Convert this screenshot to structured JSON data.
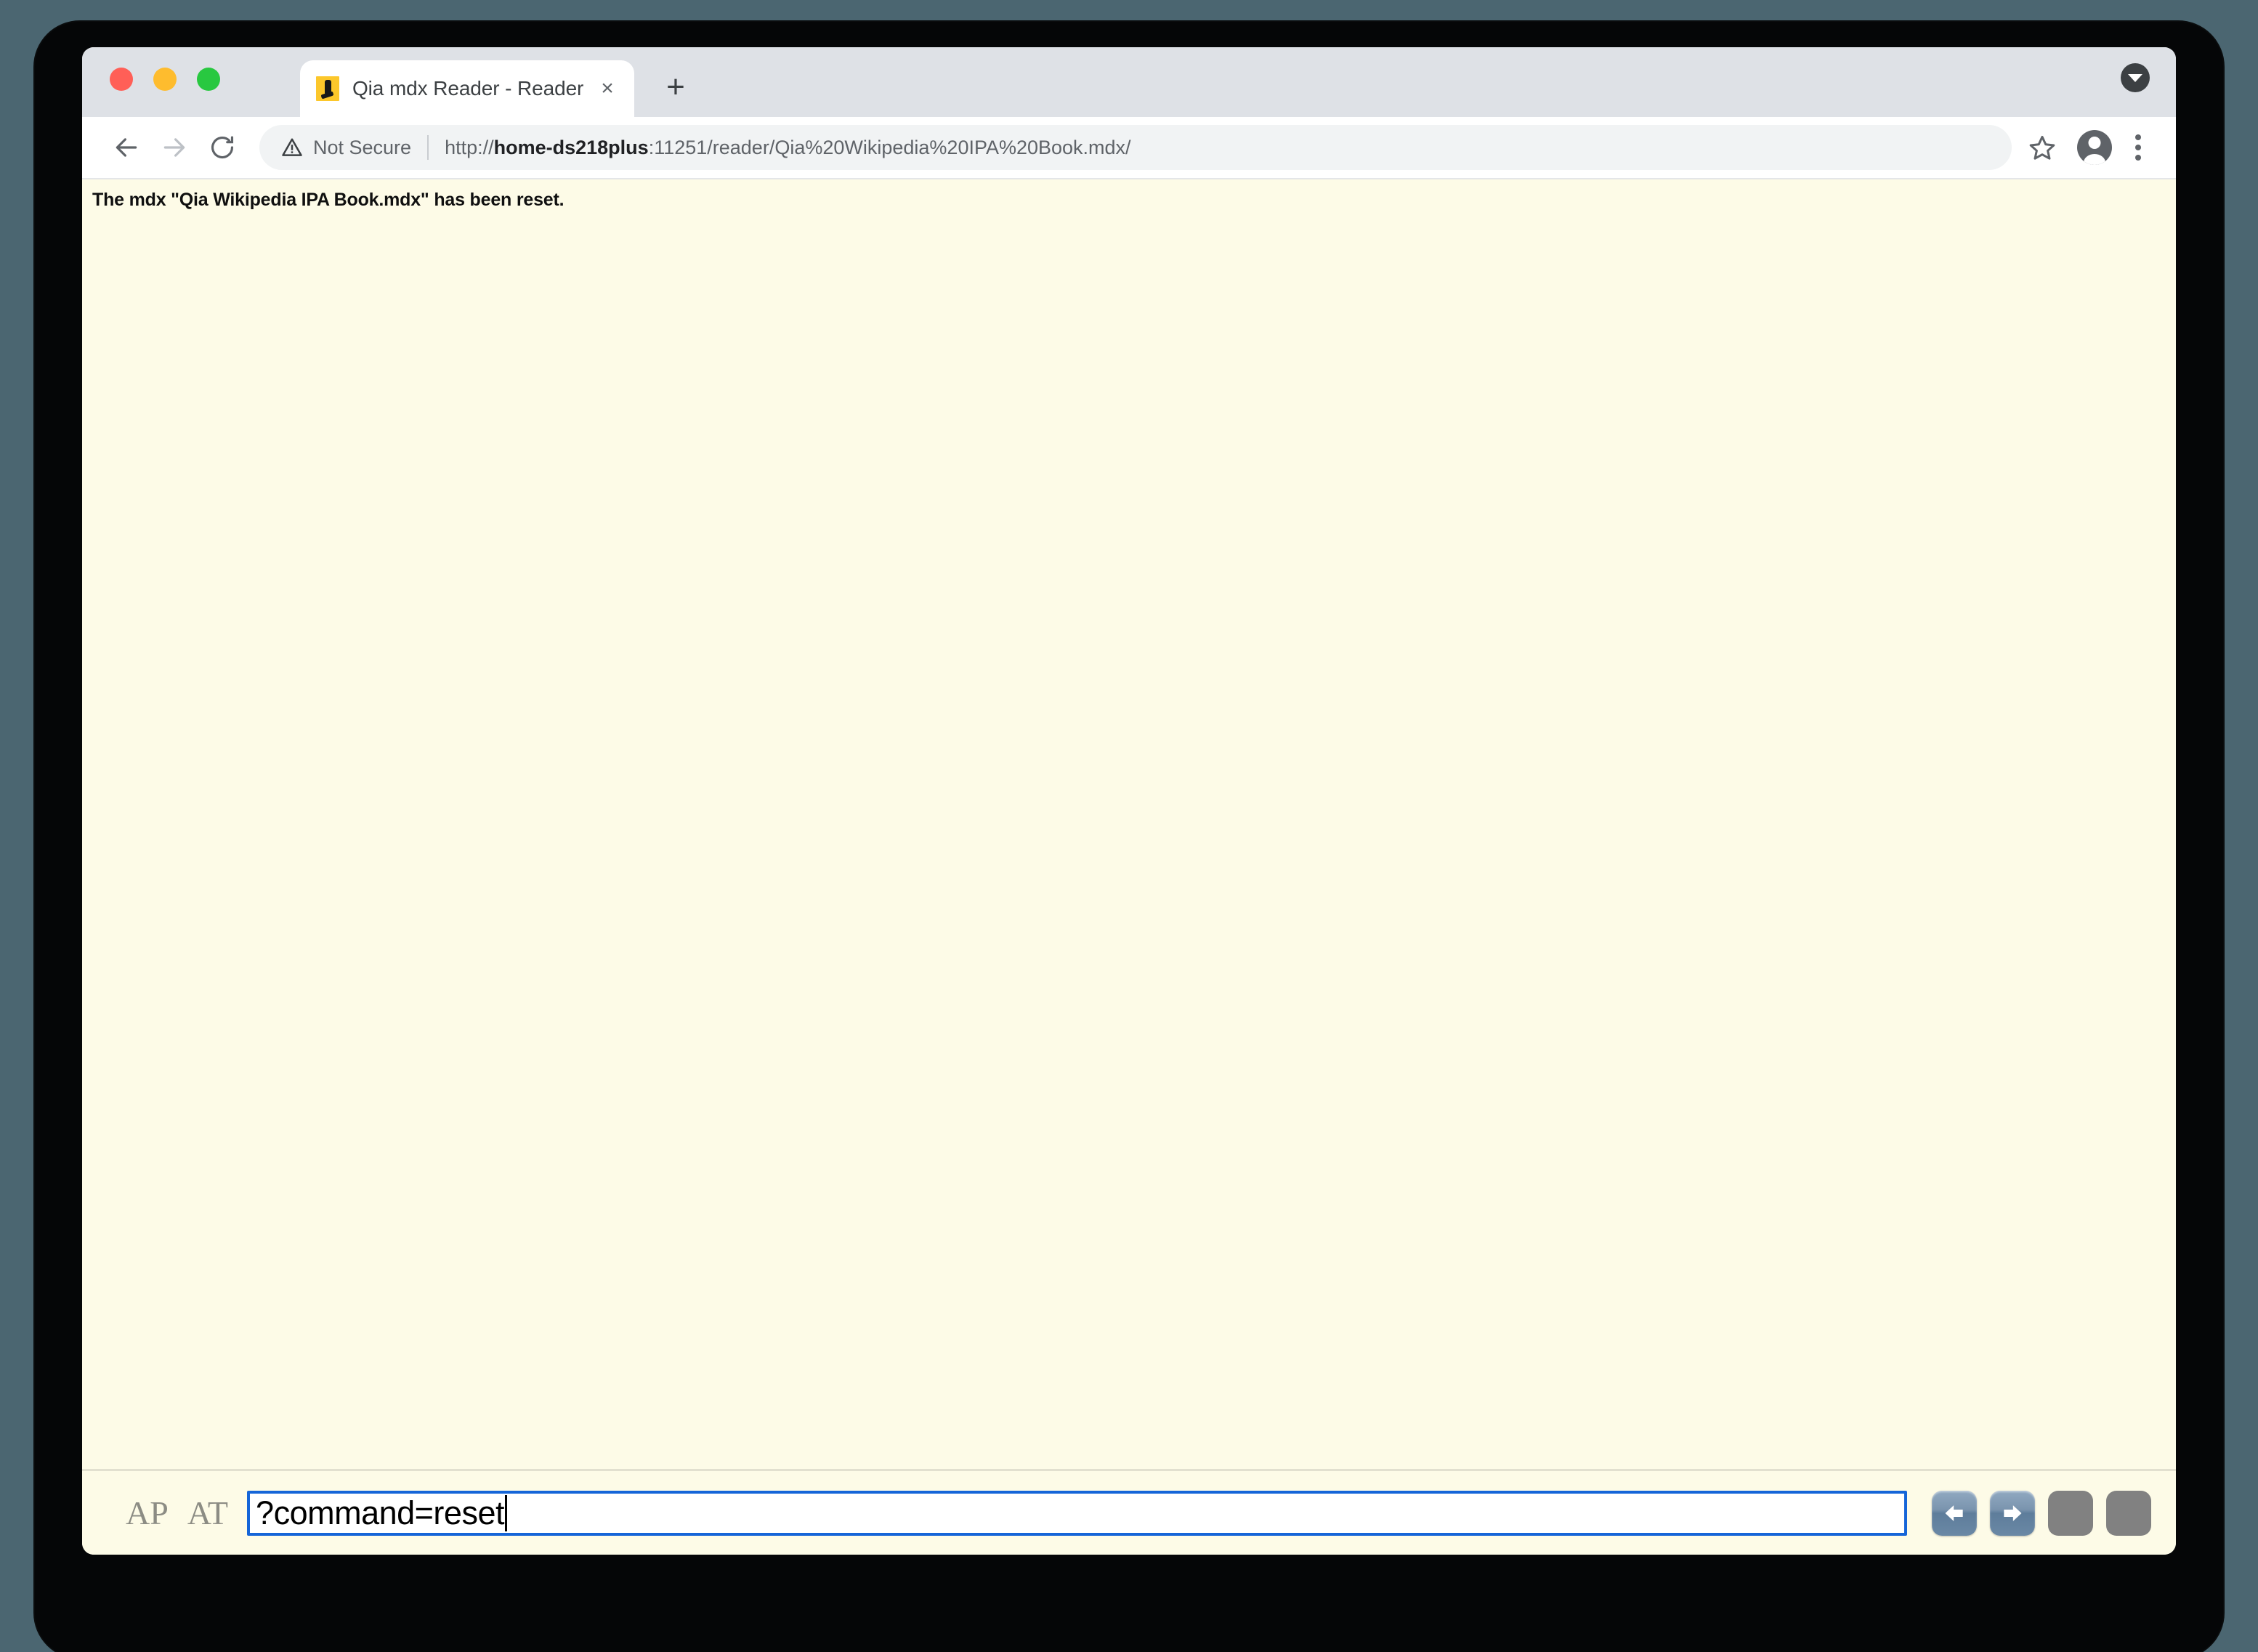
{
  "window": {
    "traffic_lights": [
      {
        "name": "close",
        "color": "#ff5f57"
      },
      {
        "name": "minimize",
        "color": "#febc2e"
      },
      {
        "name": "maximize",
        "color": "#28c840"
      }
    ]
  },
  "browser": {
    "tab": {
      "title": "Qia mdx Reader - Reader",
      "favicon_name": "mdx-reader-favicon",
      "close_label": "×"
    },
    "new_tab_label": "+",
    "tab_search_icon": "chevron-down-circle-icon",
    "toolbar": {
      "back_icon": "arrow-left-icon",
      "forward_icon": "arrow-right-icon",
      "reload_icon": "reload-icon",
      "security_icon": "warning-triangle-icon",
      "security_label": "Not Secure",
      "url_scheme": "http://",
      "url_host": "home-ds218plus",
      "url_rest": ":11251/reader/Qia%20Wikipedia%20IPA%20Book.mdx/",
      "bookmark_icon": "star-icon",
      "profile_icon": "profile-avatar-icon",
      "menu_icon": "three-dot-menu-icon"
    }
  },
  "page": {
    "message": "The mdx \"Qia Wikipedia IPA Book.mdx\" has been reset.",
    "background_color": "#fdfbe7"
  },
  "bottom_bar": {
    "mode_labels": [
      "AP",
      "AT"
    ],
    "command_input": {
      "value": "?command=reset",
      "placeholder": "",
      "focused": true,
      "border_color": "#1565d8"
    },
    "buttons": [
      {
        "name": "nav-back-button",
        "icon": "arrow-left-icon",
        "state": "enabled"
      },
      {
        "name": "nav-forward-button",
        "icon": "arrow-right-icon",
        "state": "enabled"
      },
      {
        "name": "tool-button-3",
        "icon": "blank-icon",
        "state": "disabled"
      },
      {
        "name": "tool-button-4",
        "icon": "blank-icon",
        "state": "disabled"
      }
    ]
  }
}
